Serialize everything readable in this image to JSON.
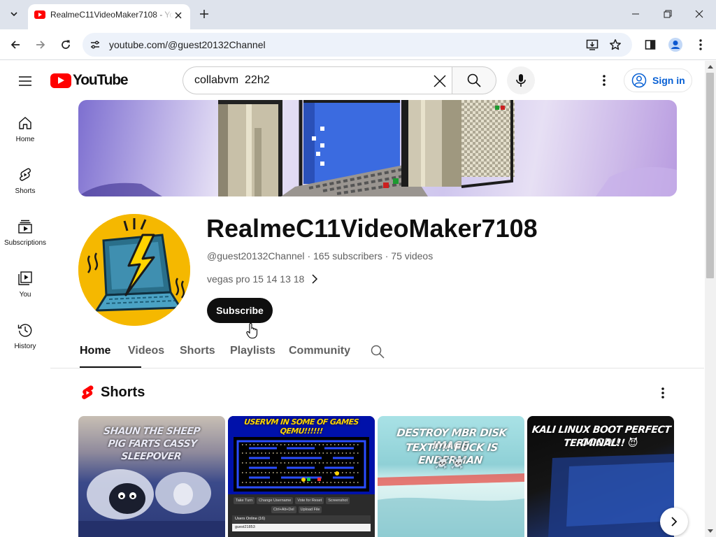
{
  "browser": {
    "tab_title": "RealmeC11VideoMaker7108 - YouTube",
    "url": "youtube.com/@guest20132Channel",
    "icons": [
      "tab-search-icon",
      "close-icon",
      "plus-icon",
      "minimize-icon",
      "restore-icon",
      "close-icon",
      "back-arrow-icon",
      "forward-arrow-icon",
      "reload-icon",
      "site-info-icon",
      "install-app-icon",
      "star-icon",
      "side-panel-icon",
      "profile-icon",
      "kebab-menu-icon"
    ]
  },
  "masthead": {
    "logo_text": "YouTube",
    "search_value": "collabvm  22h2",
    "sign_in_label": "Sign in"
  },
  "guide": {
    "items": [
      {
        "label": "Home",
        "icon": "home-icon"
      },
      {
        "label": "Shorts",
        "icon": "shorts-icon"
      },
      {
        "label": "Subscriptions",
        "icon": "subscriptions-icon"
      },
      {
        "label": "You",
        "icon": "you-library-icon"
      },
      {
        "label": "History",
        "icon": "history-icon"
      }
    ]
  },
  "channel": {
    "name": "RealmeC11VideoMaker7108",
    "handle": "@guest20132Channel",
    "subscribers": "165 subscribers",
    "videos": "75 videos",
    "separator": "·",
    "description": "vegas pro 15 14 13 18",
    "subscribe_label": "Subscribe"
  },
  "tabs": [
    {
      "label": "Home",
      "active": true
    },
    {
      "label": "Videos",
      "active": false
    },
    {
      "label": "Shorts",
      "active": false
    },
    {
      "label": "Playlists",
      "active": false
    },
    {
      "label": "Community",
      "active": false
    }
  ],
  "shorts_shelf": {
    "title": "Shorts",
    "items": [
      {
        "overlay_line1": "SHAUN THE SHEEP",
        "overlay_line2": "PIG FARTS CASSY SLEEPOVER"
      },
      {
        "overlay_line1": "USERVM IN SOME OF GAMES",
        "overlay_line2": "QEMU!!!!!!",
        "ui_buttons": [
          "Take Turn",
          "Change Username",
          "Vote for Reset",
          "Screenshot",
          "Ctrl+Alt+Del",
          "Upload File"
        ],
        "users_label": "Users Online (16)",
        "user_row": "guest21853"
      },
      {
        "overlay_line1": "DESTROY MBR DISK IMAGE",
        "overlay_line2": "TEXT!!!! FUCK IS ENDERMAN",
        "overlay_line3": "☠️☠️"
      },
      {
        "overlay_line1": "KALI LINUX BOOT PERFECT GOOD!!",
        "overlay_line2": "TERMINAL!! 😈"
      }
    ]
  },
  "colors": {
    "youtube_red": "#ff0000",
    "link_blue": "#065fd4",
    "avatar_yellow": "#f5b800",
    "subscribe_bg": "#0f0f0f"
  }
}
